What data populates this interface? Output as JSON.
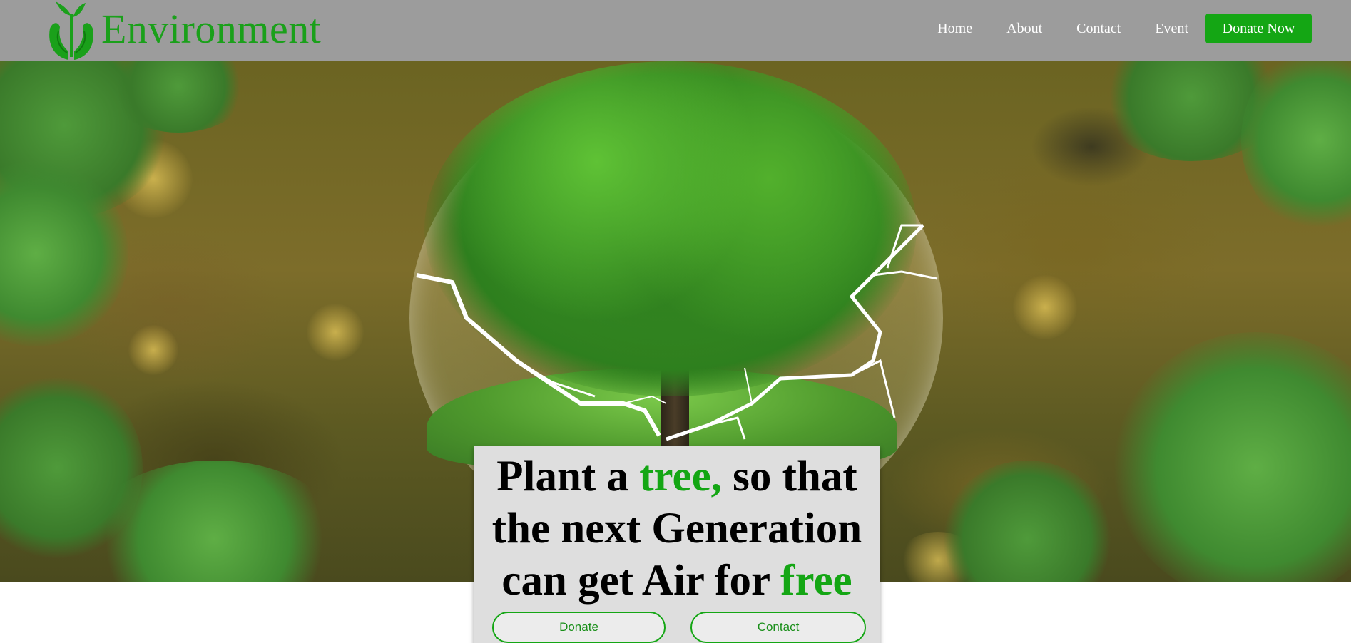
{
  "header": {
    "brand_name": "Environment",
    "logo_icon": "sprout-hands-icon",
    "nav": {
      "home": "Home",
      "about": "About",
      "contact": "Contact",
      "event": "Event"
    },
    "donate_now_label": "Donate Now"
  },
  "hero": {
    "image": "tree-in-cracked-glass-globe",
    "headline": {
      "part1": "Plant a ",
      "highlight1": "tree,",
      "part2": " so that the next Generation can get Air for ",
      "highlight2": "free"
    },
    "buttons": {
      "donate": "Donate",
      "contact": "Contact"
    }
  },
  "colors": {
    "header_bg": "#9c9c9c",
    "accent_green": "#14a614",
    "card_bg": "#dedede"
  }
}
